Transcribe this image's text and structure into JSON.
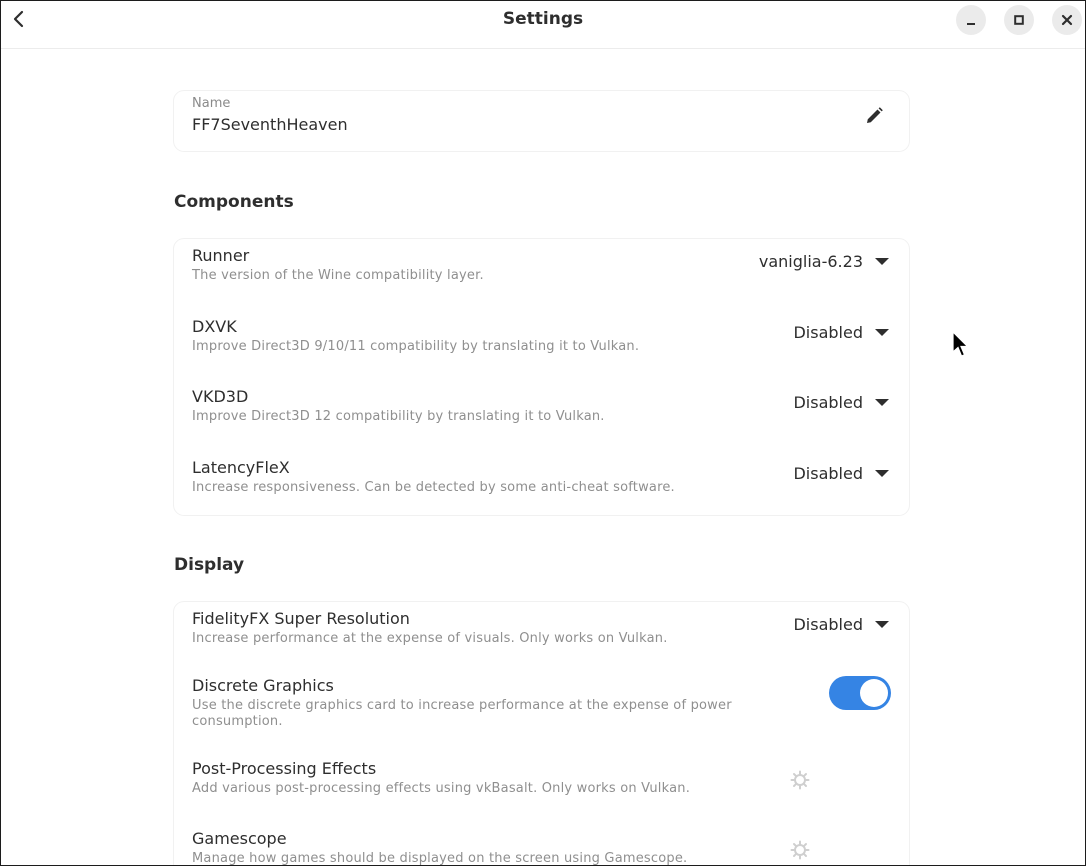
{
  "window": {
    "title": "Settings"
  },
  "name_card": {
    "label": "Name",
    "value": "FF7SeventhHeaven"
  },
  "components": {
    "heading": "Components",
    "items": [
      {
        "title": "Runner",
        "subtitle": "The version of the Wine compatibility layer.",
        "value": "vaniglia-6.23"
      },
      {
        "title": "DXVK",
        "subtitle": "Improve Direct3D 9/10/11 compatibility by translating it to Vulkan.",
        "value": "Disabled"
      },
      {
        "title": "VKD3D",
        "subtitle": "Improve Direct3D 12 compatibility by translating it to Vulkan.",
        "value": "Disabled"
      },
      {
        "title": "LatencyFleX",
        "subtitle": "Increase responsiveness. Can be detected by some anti-cheat software.",
        "value": "Disabled"
      }
    ]
  },
  "display": {
    "heading": "Display",
    "items": [
      {
        "title": "FidelityFX Super Resolution",
        "subtitle": "Increase performance at the expense of visuals. Only works on Vulkan.",
        "value": "Disabled"
      },
      {
        "title": "Discrete Graphics",
        "subtitle": "Use the discrete graphics card to increase performance at the expense of power consumption.",
        "toggle_on": true
      },
      {
        "title": "Post-Processing Effects",
        "subtitle": "Add various post-processing effects using vkBasalt. Only works on Vulkan.",
        "icon": "gear-icon"
      },
      {
        "title": "Gamescope",
        "subtitle": "Manage how games should be displayed on the screen using Gamescope.",
        "icon": "gear-icon"
      }
    ]
  },
  "colors": {
    "accent": "#3584e4",
    "text": "#2e2e2e",
    "subtext": "#8f8f8f"
  }
}
